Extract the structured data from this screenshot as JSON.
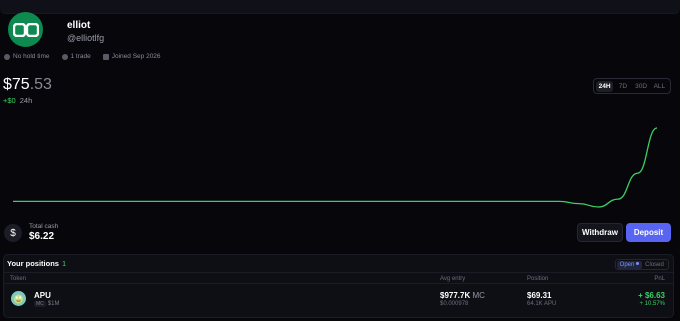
{
  "profile": {
    "username": "elliot",
    "handle": "@elliotlfg",
    "meta": {
      "hold_time": "No hold time",
      "trades": "1 trade",
      "joined": "Joined Sep 2026"
    }
  },
  "portfolio": {
    "value_main": "$75",
    "value_cents": ".53",
    "change": "+$0",
    "period": "24h",
    "ranges": [
      "24H",
      "7D",
      "30D",
      "ALL"
    ],
    "active_range": "24H"
  },
  "cash": {
    "label": "Total cash",
    "value": "$6.22",
    "icon": "dollar-icon"
  },
  "actions": {
    "withdraw": "Withdraw",
    "deposit": "Deposit"
  },
  "positions": {
    "title": "Your positions",
    "count": "1",
    "toggle": {
      "open": "Open",
      "closed": "Closed"
    },
    "columns": {
      "token": "Token",
      "avg_entry": "Avg entry",
      "position": "Position",
      "pnl": "PnL"
    },
    "rows": [
      {
        "token": "APU",
        "mc_badge": "MC",
        "mc": "$1M",
        "avg_entry_value": "$977.7K",
        "avg_entry_unit": "MC",
        "avg_entry_sub": "$0.000978",
        "position_value": "$69.31",
        "position_sub": "64.1K APU",
        "pnl_value": "+ $6.63",
        "pnl_pct": "+ 10.57%"
      }
    ]
  },
  "colors": {
    "accent": "#5865f2",
    "positive": "#3ccf63",
    "background": "#07070b",
    "avatar": "#0d8a4f"
  },
  "chart_data": {
    "type": "line",
    "series": [
      {
        "values": [
          69.0,
          69.0,
          69.0,
          69.0,
          69.0,
          69.0,
          69.0,
          69.0,
          69.0,
          69.0,
          69.0,
          69.0,
          69.0,
          69.0,
          69.0,
          69.0,
          69.0,
          69.0,
          69.0,
          69.0,
          69.0,
          69.0,
          69.0,
          69.0,
          69.0,
          69.0,
          69.0,
          69.0,
          69.0,
          68.8,
          68.5,
          69.2,
          71.5,
          75.53
        ]
      }
    ],
    "color": "#3ccf63",
    "grid": false
  }
}
